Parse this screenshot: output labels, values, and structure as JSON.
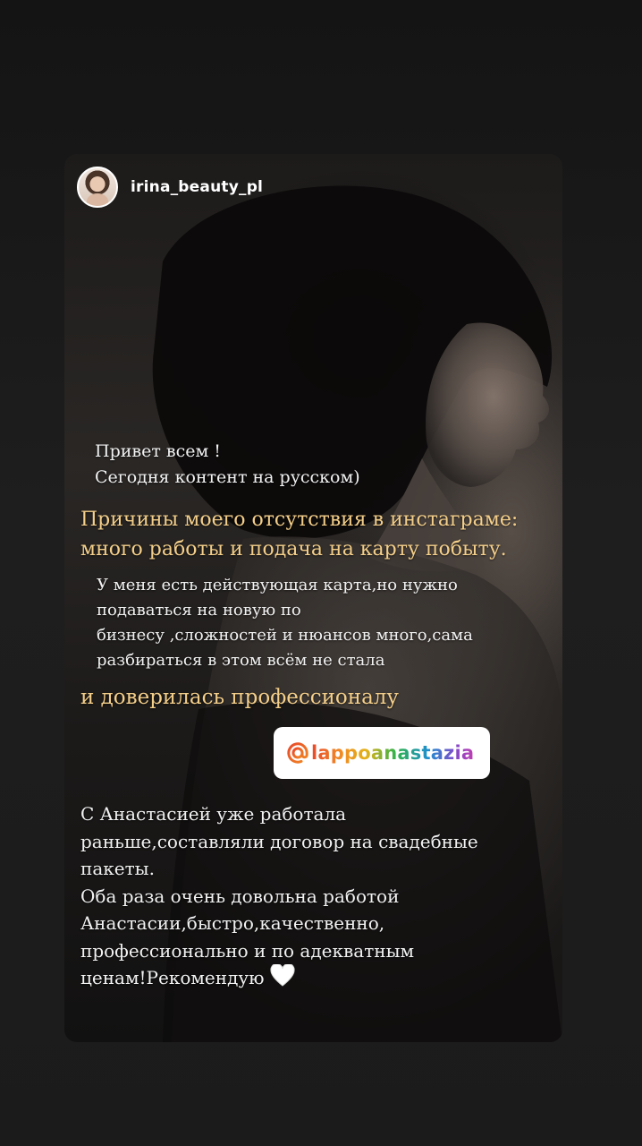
{
  "profile": {
    "username": "irina_beauty_pl"
  },
  "story": {
    "greeting_lines": [
      "Привет всем !",
      "Сегодня контент на русском)"
    ],
    "reasons_lines": [
      "Причины моего отсутствия в инстаграме:",
      "много работы и подача на карту побыту."
    ],
    "card_info_lines": [
      "У меня есть действующая карта,но нужно",
      "подаваться на новую по",
      "бизнесу ,сложностей и нюансов много,сама",
      "разбираться в этом всём не стала"
    ],
    "trusted_line": "и доверилась профессионалу",
    "mention": {
      "handle": "lappoanastazia",
      "icon": "at-sign-icon"
    },
    "review_lines": [
      "С Анастасией уже работала",
      "раньше,составляли договор на свадебные",
      "пакеты.",
      "Оба раза очень довольна работой",
      "Анастасии,быстро,качественно,",
      "профессионально и по адекватным",
      "ценам!Рекомендую"
    ],
    "review_emoji": "white-heart-icon"
  },
  "colors": {
    "accent_gold": "#f4cf8a",
    "text_white": "#f2f2f2",
    "background": "#1c1c1c"
  }
}
